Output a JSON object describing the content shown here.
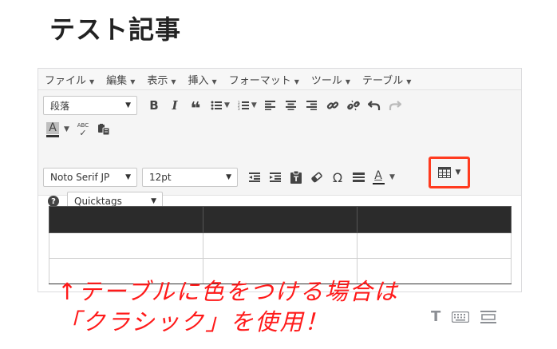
{
  "page": {
    "title": "テスト記事"
  },
  "menubar": {
    "items": [
      "ファイル",
      "編集",
      "表示",
      "挿入",
      "フォーマット",
      "ツール",
      "テーブル"
    ]
  },
  "toolbar": {
    "format_select": "段落",
    "font_family_select": "Noto Serif JP",
    "font_size_select": "12pt",
    "shortcode_select": "Quicktags",
    "spellcheck_icon_text": "ABC",
    "text_color_glyph": "A",
    "omega_glyph": "Ω",
    "quote_glyph": "❝"
  },
  "table": {
    "header_columns": 3,
    "body_rows": 2
  },
  "annotation": {
    "line1": "↑テーブルに色をつける場合は",
    "line2": "「クラシック」を使用！"
  },
  "status": {
    "text_mode_glyph": "T"
  },
  "colors": {
    "highlight": "#ff3b1f",
    "annotation": "#ff1a1a",
    "table_header": "#2b2b2b"
  }
}
